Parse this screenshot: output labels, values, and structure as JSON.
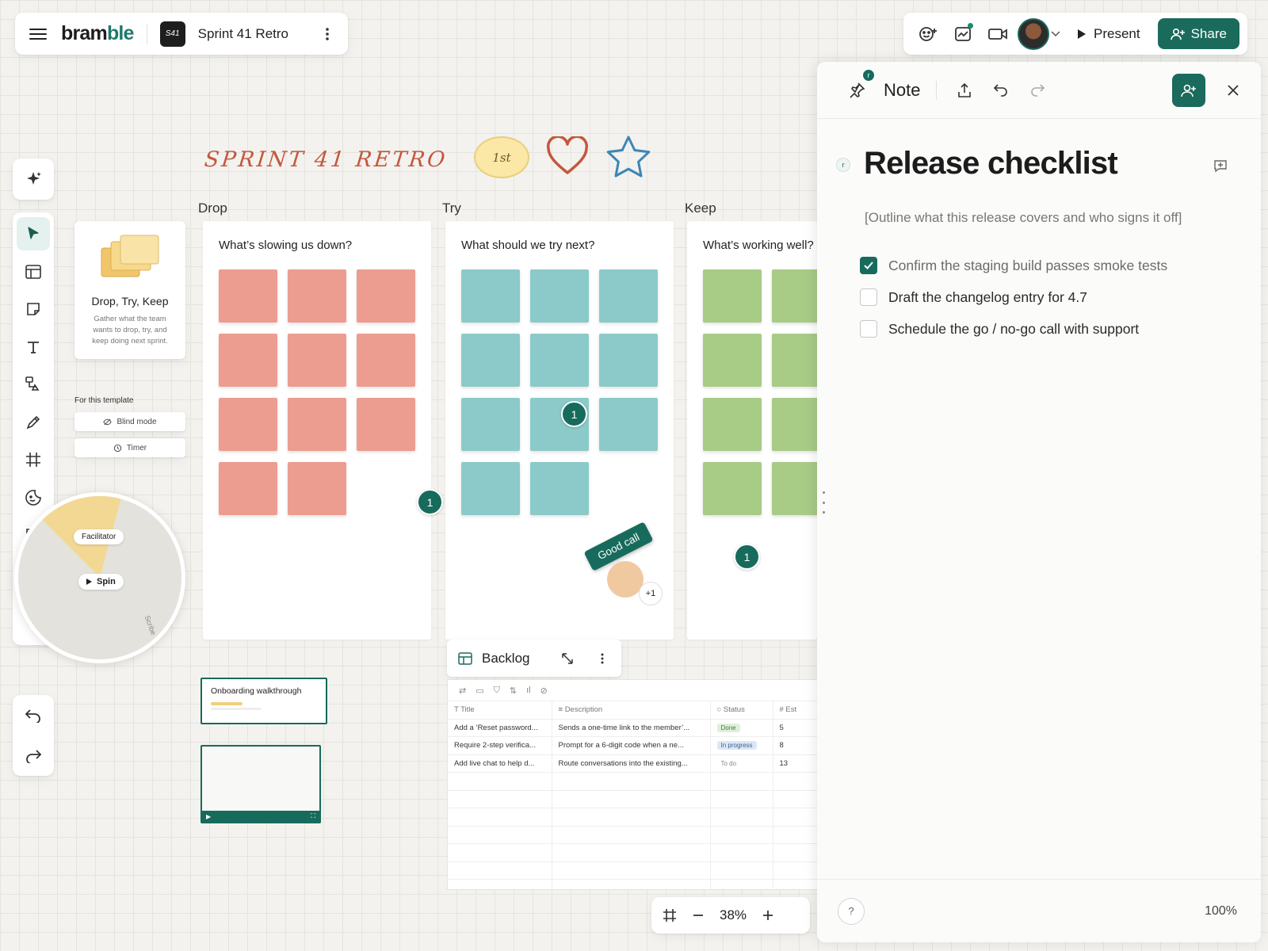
{
  "app": {
    "logo_main": "bram",
    "logo_accent": "ble"
  },
  "board": {
    "badge": "S41",
    "title": "Sprint 41 Retro"
  },
  "topbar": {
    "present_label": "Present",
    "share_label": "Share"
  },
  "toolbar": {
    "tools": [
      "ai-sparkle-icon",
      "select-pointer-icon",
      "template-icon",
      "sticky-note-icon",
      "text-icon",
      "shapes-connector-icon",
      "pen-icon",
      "frame-icon",
      "sticker-icon",
      "comment-icon",
      "clipboard-icon",
      "add-icon"
    ],
    "active_tool": "select-pointer-icon"
  },
  "template": {
    "name": "Drop, Try, Keep",
    "description": "Gather what the team wants to drop, try, and keep doing next sprint.",
    "section_label": "For this template",
    "blind_mode_label": "Blind mode",
    "timer_label": "Timer"
  },
  "spinner": {
    "facilitator_label": "Facilitator",
    "spin_label": "Spin",
    "scribe_label": "Scribe"
  },
  "board_header": {
    "hand_title": "SPRINT 41 RETRO",
    "badge_label": "1st"
  },
  "columns": [
    {
      "label": "Drop",
      "question": "What’s slowing us down?",
      "color": "#ec9d90",
      "sticky_count": 11,
      "votes": [
        {
          "count": "1"
        }
      ]
    },
    {
      "label": "Try",
      "question": "What should we try next?",
      "color": "#8ccac9",
      "sticky_count": 11,
      "votes": [
        {
          "count": "1"
        }
      ]
    },
    {
      "label": "Keep",
      "question": "What’s working well?",
      "color": "#a8cb86",
      "sticky_count": 8,
      "votes": [
        {
          "count": "1"
        }
      ]
    }
  ],
  "reaction": {
    "tag": "Good call",
    "count": "+1"
  },
  "thumbnails": {
    "onboarding_title": "Onboarding walkthrough"
  },
  "backlog": {
    "title": "Backlog",
    "columns": [
      "Title",
      "Description",
      "Status",
      "# Est"
    ],
    "rows": [
      {
        "title": "Add a ‘Reset password...",
        "description": "Sends a one-time link to the member’...",
        "status": "Done",
        "status_color": "#dff0da",
        "status_text_color": "#4b7a3c",
        "est": "5"
      },
      {
        "title": "Require 2-step verifica...",
        "description": "Prompt for a 6-digit code when a ne...",
        "status": "In progress",
        "status_color": "#dce7f5",
        "status_text_color": "#3d6294",
        "est": "8"
      },
      {
        "title": "Add live chat to help d...",
        "description": "Route conversations into the existing...",
        "status": "To do",
        "status_color": "#ffffff",
        "status_text_color": "#888888",
        "est": "13"
      }
    ],
    "empty_rows": 7
  },
  "zoom": {
    "level": "38%"
  },
  "note": {
    "header_label": "Note",
    "collaborator_initial": "r",
    "title": "Release checklist",
    "subtitle": "[Outline what this release covers and who signs it off]",
    "items": [
      {
        "label": "Confirm the staging build passes smoke tests",
        "checked": true
      },
      {
        "label": "Draft the changelog entry for 4.7",
        "checked": false
      },
      {
        "label": "Schedule the go / no-go call with support",
        "checked": false
      }
    ],
    "help_label": "?",
    "zoom_label": "100%"
  },
  "colors": {
    "accent": "#1a6b5c",
    "drop": "#ec9d90",
    "try": "#8ccac9",
    "keep": "#a8cb86"
  }
}
